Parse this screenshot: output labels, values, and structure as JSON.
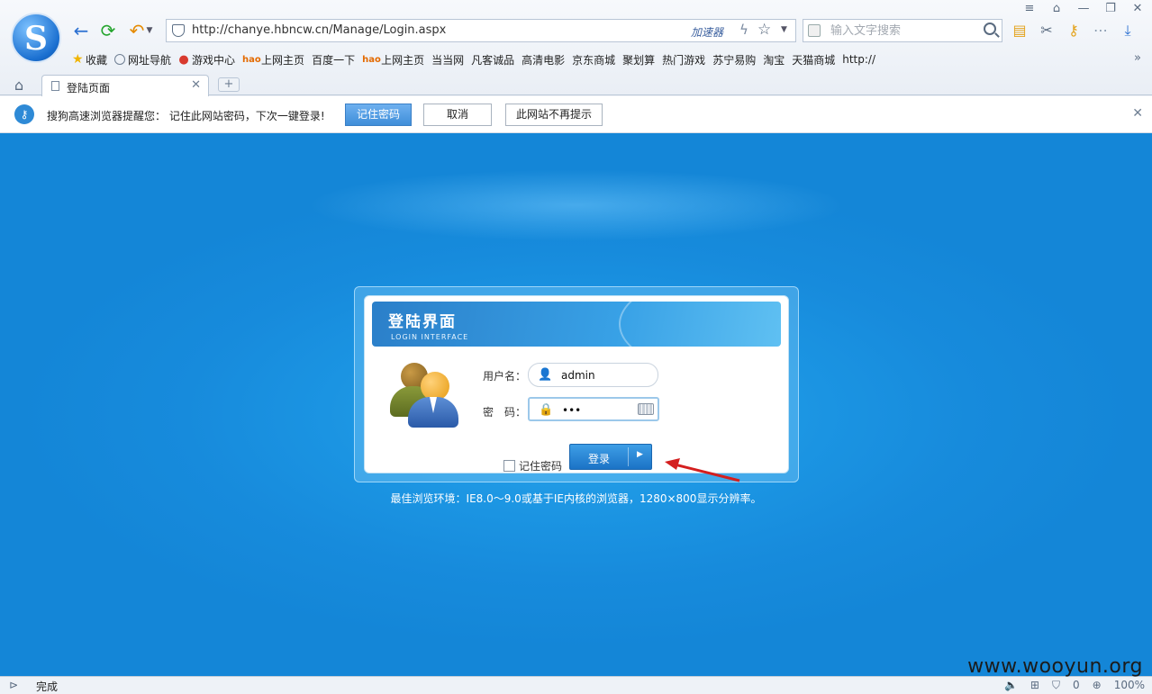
{
  "browser": {
    "window_controls": [
      "≡",
      "👕",
      "—",
      "❐",
      "✕"
    ],
    "address": {
      "url": "http://chanye.hbncw.cn/Manage/Login.aspx",
      "accelerator": "加速器"
    },
    "search": {
      "placeholder": "输入文字搜索"
    },
    "bookmarks": [
      {
        "label": "收藏",
        "icon": "star"
      },
      {
        "label": "网址导航",
        "icon": "globe"
      },
      {
        "label": "游戏中心",
        "icon": "game"
      },
      {
        "label": "上网主页",
        "icon": "hao"
      },
      {
        "label": "百度一下",
        "icon": "page"
      },
      {
        "label": "上网主页",
        "icon": "hao"
      },
      {
        "label": "当当网",
        "icon": "page"
      },
      {
        "label": "凡客诚品",
        "icon": "page"
      },
      {
        "label": "高清电影",
        "icon": "page"
      },
      {
        "label": "京东商城",
        "icon": "page"
      },
      {
        "label": "聚划算",
        "icon": "page"
      },
      {
        "label": "热门游戏",
        "icon": "page"
      },
      {
        "label": "苏宁易购",
        "icon": "page"
      },
      {
        "label": "淘宝",
        "icon": "page"
      },
      {
        "label": "天猫商城",
        "icon": "page"
      },
      {
        "label": "http://",
        "icon": "page"
      }
    ],
    "tab": {
      "title": "登陆页面"
    }
  },
  "notification": {
    "message": "搜狗高速浏览器提醒您： 记住此网站密码，下次一键登录!",
    "save_password": "记住密码",
    "cancel": "取消",
    "never_for_site": "此网站不再提示"
  },
  "login": {
    "title": "登陆界面",
    "subtitle": "LOGIN INTERFACE",
    "username_label": "用户名：",
    "username_value": "admin",
    "password_label": "密　码：",
    "password_value": "•••",
    "remember_label": "记住密码",
    "remember_checked": false,
    "submit_label": "登录",
    "footnote": "最佳浏览环境：IE8.0～9.0或基于IE内核的浏览器，1280×800显示分辨率。"
  },
  "status": {
    "text": "完成",
    "zero_count": "0",
    "zoom": "100%"
  },
  "watermark": "www.wooyun.org",
  "colors": {
    "page_bg": "#1b94e2",
    "accent": "#2b7fc9",
    "annotation_arrow": "#d41f1f"
  }
}
